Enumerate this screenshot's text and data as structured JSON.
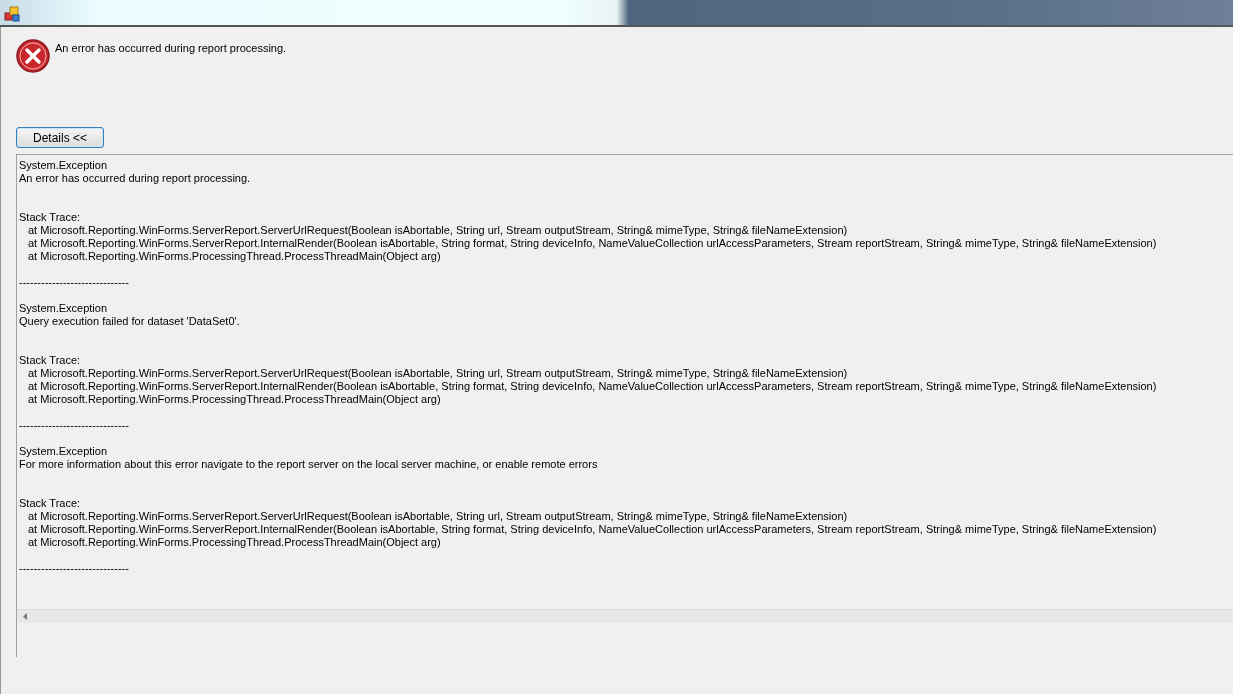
{
  "dialog": {
    "message": "An error has occurred during report processing.",
    "details_button": "Details <<"
  },
  "details": [
    {
      "type": "System.Exception",
      "message": "An error has occurred during report processing.",
      "stack_label": "Stack Trace:",
      "trace": [
        "at Microsoft.Reporting.WinForms.ServerReport.ServerUrlRequest(Boolean isAbortable, String url, Stream outputStream, String& mimeType, String& fileNameExtension)",
        "at Microsoft.Reporting.WinForms.ServerReport.InternalRender(Boolean isAbortable, String format, String deviceInfo, NameValueCollection urlAccessParameters, Stream reportStream, String& mimeType, String& fileNameExtension)",
        "at Microsoft.Reporting.WinForms.ProcessingThread.ProcessThreadMain(Object arg)"
      ],
      "separator": "------------------------------"
    },
    {
      "type": "System.Exception",
      "message": "Query execution failed for dataset 'DataSet0'.",
      "stack_label": "Stack Trace:",
      "trace": [
        "at Microsoft.Reporting.WinForms.ServerReport.ServerUrlRequest(Boolean isAbortable, String url, Stream outputStream, String& mimeType, String& fileNameExtension)",
        "at Microsoft.Reporting.WinForms.ServerReport.InternalRender(Boolean isAbortable, String format, String deviceInfo, NameValueCollection urlAccessParameters, Stream reportStream, String& mimeType, String& fileNameExtension)",
        "at Microsoft.Reporting.WinForms.ProcessingThread.ProcessThreadMain(Object arg)"
      ],
      "separator": "------------------------------"
    },
    {
      "type": "System.Exception",
      "message": "For more information about this error navigate to the report server on the local server machine, or enable remote errors",
      "stack_label": "Stack Trace:",
      "trace": [
        "at Microsoft.Reporting.WinForms.ServerReport.ServerUrlRequest(Boolean isAbortable, String url, Stream outputStream, String& mimeType, String& fileNameExtension)",
        "at Microsoft.Reporting.WinForms.ServerReport.InternalRender(Boolean isAbortable, String format, String deviceInfo, NameValueCollection urlAccessParameters, Stream reportStream, String& mimeType, String& fileNameExtension)",
        "at Microsoft.Reporting.WinForms.ProcessingThread.ProcessThreadMain(Object arg)"
      ],
      "separator": "------------------------------"
    }
  ]
}
